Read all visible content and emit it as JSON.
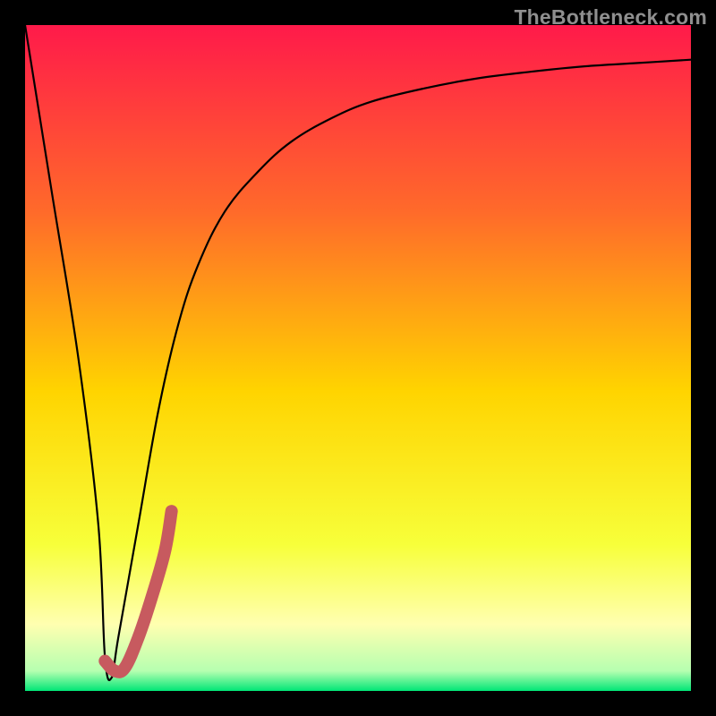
{
  "watermark": "TheBottleneck.com",
  "colors": {
    "frame": "#000000",
    "grad_top": "#ff1a4a",
    "grad_upper_mid": "#ff6a2a",
    "grad_mid": "#ffd400",
    "grad_lower_mid": "#f7ff3a",
    "grad_pale": "#ffffb0",
    "grad_green": "#00e676",
    "curve": "#000000",
    "highlight": "#c75a5f"
  },
  "chart_data": {
    "type": "line",
    "title": "",
    "xlabel": "",
    "ylabel": "",
    "xlim": [
      0,
      100
    ],
    "ylim": [
      0,
      100
    ],
    "series": [
      {
        "name": "bottleneck-curve",
        "x": [
          0,
          4,
          8,
          11,
          12,
          13,
          14,
          17,
          20,
          23,
          26,
          30,
          35,
          40,
          46,
          52,
          60,
          68,
          76,
          84,
          92,
          100
        ],
        "values": [
          100,
          75,
          50,
          25,
          5,
          2,
          8,
          25,
          42,
          55,
          64,
          72,
          78,
          82.5,
          86,
          88.5,
          90.5,
          92,
          93,
          93.8,
          94.3,
          94.8
        ]
      },
      {
        "name": "highlight-segment",
        "x": [
          12,
          13.5,
          15,
          17,
          19,
          21,
          22
        ],
        "values": [
          4.5,
          3,
          3.5,
          8,
          14,
          21,
          27
        ]
      }
    ]
  }
}
